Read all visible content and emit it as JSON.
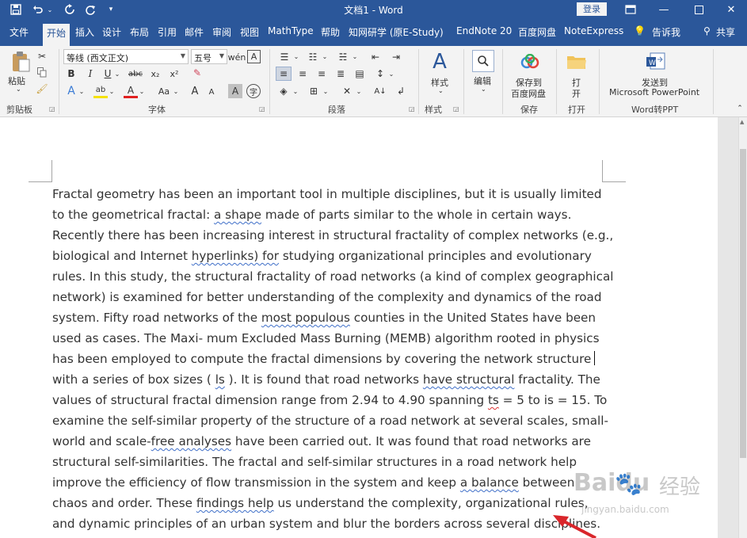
{
  "titlebar": {
    "title": "文档1 - Word",
    "login": "登录",
    "quick_access": [
      "save-icon",
      "undo-icon",
      "redo-icon",
      "refresh-icon",
      "customize-icon"
    ]
  },
  "tabs": [
    "文件",
    "开始",
    "插入",
    "设计",
    "布局",
    "引用",
    "邮件",
    "审阅",
    "视图",
    "MathType",
    "帮助",
    "知网研学 (原E-Study)",
    "EndNote 20",
    "百度网盘",
    "NoteExpress",
    "告诉我",
    "共享"
  ],
  "active_tab": "开始",
  "ribbon": {
    "clipboard": {
      "paste": "粘贴",
      "group": "剪贴板"
    },
    "font": {
      "font_name": "等线 (西文正文)",
      "font_size": "五号",
      "group": "字体",
      "bold": "B",
      "italic": "I",
      "underline": "U",
      "strike": "abc",
      "sub": "x₂",
      "sup": "x²",
      "grow": "A",
      "shrink": "A",
      "case": "Aa"
    },
    "paragraph": {
      "group": "段落"
    },
    "styles": {
      "label": "样式",
      "group": "样式"
    },
    "editing": {
      "label": "编辑"
    },
    "save_baidu": {
      "line1": "保存到",
      "line2": "百度网盘",
      "group": "保存"
    },
    "open": {
      "line1": "打",
      "line2": "开",
      "group": "打开"
    },
    "send_ppt": {
      "line1": "发送到",
      "line2": "Microsoft PowerPoint",
      "group": "Word转PPT"
    }
  },
  "document": {
    "lines": [
      [
        {
          "t": "Fractal geometry has been an important tool in multiple disciplines, but it is usually limited"
        }
      ],
      [
        {
          "t": "to the geometrical fractal: "
        },
        {
          "t": "a  shape",
          "s": 1
        },
        {
          "t": " made of parts similar to the whole in certain ways."
        }
      ],
      [
        {
          "t": "Recently there has been increasing interest in structural fractality of complex networks (e.g.,"
        }
      ],
      [
        {
          "t": "biological and Internet "
        },
        {
          "t": "hyperlinks)   for",
          "s": 1
        },
        {
          "t": " studying organizational principles and evolutionary"
        }
      ],
      [
        {
          "t": "rules. In this study, the structural fractality of road networks (a kind of complex geographical"
        }
      ],
      [
        {
          "t": "network) is examined for better understanding of the complexity and dynamics of the road"
        }
      ],
      [
        {
          "t": "system. Fifty road networks of the "
        },
        {
          "t": "most   populous",
          "s": 1
        },
        {
          "t": " counties in the United States have been"
        }
      ],
      [
        {
          "t": "used as cases. The Maxi- mum Excluded Mass Burning (MEMB) algorithm rooted in physics"
        }
      ],
      [
        {
          "t": "has been employed to compute the fractal dimensions by covering the network structure"
        },
        {
          "caret": 1
        }
      ],
      [
        {
          "t": "with a series of box sizes ( "
        },
        {
          "t": "ls",
          "s": 1
        },
        {
          "t": " ). It is found that road networks "
        },
        {
          "t": "have   structural",
          "s": 1
        },
        {
          "t": " fractality. The"
        }
      ],
      [
        {
          "t": "values of structural fractal dimension range from 2.94 to 4.90 spanning "
        },
        {
          "t": "ts",
          "s": 2
        },
        {
          "t": " = 5 to is = 15. To"
        }
      ],
      [
        {
          "t": "examine the self-similar property of the structure of a road network at several scales, small-"
        }
      ],
      [
        {
          "t": "world and scale-"
        },
        {
          "t": "free   analyses",
          "s": 1
        },
        {
          "t": " have been carried out. It was found that road networks are"
        }
      ],
      [
        {
          "t": "structural self-similarities. The fractal and self-similar structures in a road network help"
        }
      ],
      [
        {
          "t": "improve the efficiency of flow transmission in the system and keep "
        },
        {
          "t": "a   balance",
          "s": 1
        },
        {
          "t": " between"
        }
      ],
      [
        {
          "t": "chaos and order. These "
        },
        {
          "t": "findings   help",
          "s": 1
        },
        {
          "t": " us understand the complexity, organizational rules,"
        }
      ],
      [
        {
          "t": "and dynamic principles of an urban system and blur the borders across several disciplines."
        }
      ]
    ]
  },
  "watermark": {
    "brand": "Baidu",
    "cn": "经验",
    "url": "jingyan.baidu.com"
  },
  "colors": {
    "word_blue": "#2b579a",
    "ribbon_bg": "#f3f3f3",
    "arrow": "#d9262b"
  }
}
